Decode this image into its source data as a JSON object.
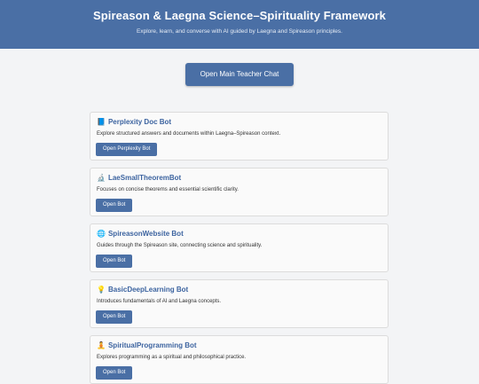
{
  "header": {
    "title": "Spireason & Laegna Science–Spirituality Framework",
    "subtitle": "Explore, learn, and converse with AI guided by Laegna and Spireason principles."
  },
  "main_button_label": "Open Main Teacher Chat",
  "colors": {
    "accent": "#4a6fa5",
    "link": "#3d64a0",
    "background": "#f3f4f6"
  },
  "bots": [
    {
      "icon": "📘",
      "icon_name": "book-icon",
      "title": "Perplexity Doc Bot",
      "description": "Explore structured answers and documents within Laegna–Spireason context.",
      "button": "Open Perplexity Bot"
    },
    {
      "icon": "🔬",
      "icon_name": "microscope-icon",
      "title": "LaeSmallTheoremBot",
      "description": "Focuses on concise theorems and essential scientific clarity.",
      "button": "Open Bot"
    },
    {
      "icon": "🌐",
      "icon_name": "globe-icon",
      "title": "SpireasonWebsite Bot",
      "description": "Guides through the Spireason site, connecting science and spirituality.",
      "button": "Open Bot"
    },
    {
      "icon": "💡",
      "icon_name": "lightbulb-icon",
      "title": "BasicDeepLearning Bot",
      "description": "Introduces fundamentals of AI and Laegna concepts.",
      "button": "Open Bot"
    },
    {
      "icon": "🧘",
      "icon_name": "meditation-icon",
      "title": "SpiritualProgramming Bot",
      "description": "Explores programming as a spiritual and philosophical practice.",
      "button": "Open Bot"
    }
  ]
}
